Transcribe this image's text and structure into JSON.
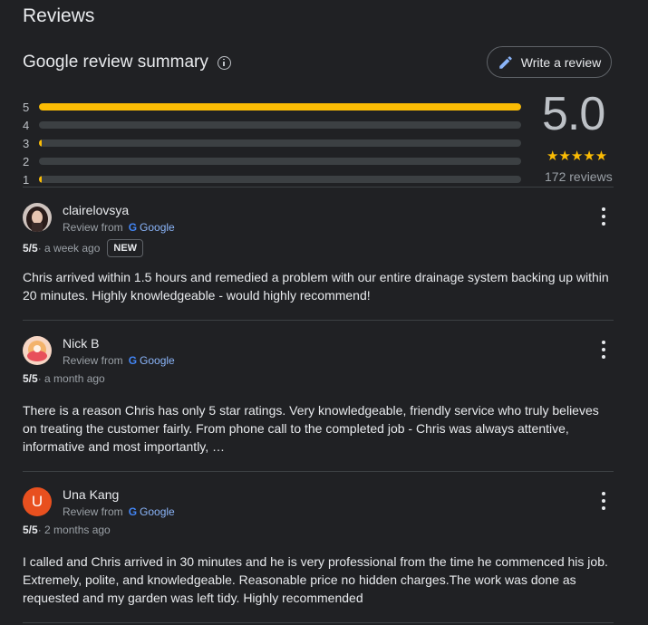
{
  "page": {
    "title": "Reviews"
  },
  "summary": {
    "title": "Google review summary",
    "write_review_label": "Write a review",
    "rating": "5.0",
    "stars": "★★★★★",
    "review_count": "172 reviews",
    "distribution": [
      {
        "stars": "5",
        "fraction": 1.0
      },
      {
        "stars": "4",
        "fraction": 0.0
      },
      {
        "stars": "3",
        "fraction": 0.006
      },
      {
        "stars": "2",
        "fraction": 0.0
      },
      {
        "stars": "1",
        "fraction": 0.006
      }
    ],
    "colors": {
      "accent": "#fbbc04",
      "track": "#3c4043"
    }
  },
  "reviews": [
    {
      "name": "clairelovsya",
      "source_prefix": "Review from",
      "source_name": "Google",
      "rating": "5/5",
      "time": " · a week ago",
      "badge": "NEW",
      "text": "Chris arrived within 1.5 hours and remedied a problem with our entire drainage system backing up within 20 minutes. Highly knowledgeable - would highly recommend!"
    },
    {
      "name": "Nick B",
      "source_prefix": "Review from",
      "source_name": "Google",
      "rating": "5/5",
      "time": " · a month ago",
      "text": "There is a reason Chris has only 5 star ratings. Very knowledgeable, friendly service who truly believes on treating the customer fairly. From phone call to the completed job - Chris was always attentive, informative and most importantly, …"
    },
    {
      "name": "Una Kang",
      "avatar_letter": "U",
      "source_prefix": "Review from",
      "source_name": "Google",
      "rating": "5/5",
      "time": " · 2 months ago",
      "text": "I called and Chris arrived in 30 minutes and he is very professional from the time he commenced his job. Extremely, polite, and knowledgeable. Reasonable price no hidden charges.The work was done as requested and my garden was left tidy. Highly recommended"
    }
  ]
}
